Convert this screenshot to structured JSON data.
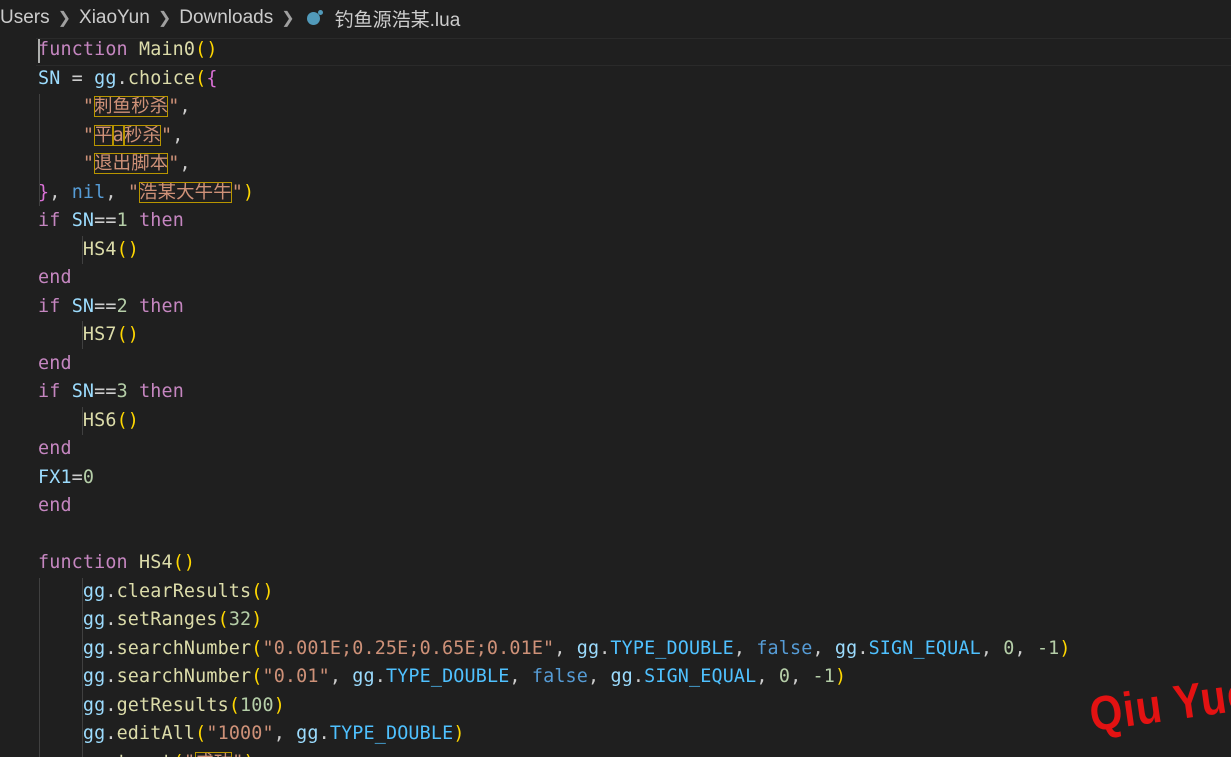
{
  "breadcrumb": {
    "items": [
      "Users",
      "XiaoYun",
      "Downloads"
    ],
    "file_name": "钓鱼源浩某.lua",
    "file_icon": "lua-file-icon"
  },
  "code": {
    "lines": [
      [
        [
          "kw",
          "function"
        ],
        [
          "pl",
          " "
        ],
        [
          "fn",
          "Main0"
        ],
        [
          "br1",
          "()"
        ]
      ],
      [
        [
          "vr",
          "SN"
        ],
        [
          "pl",
          " = "
        ],
        [
          "vr",
          "gg"
        ],
        [
          "pl",
          "."
        ],
        [
          "fn",
          "choice"
        ],
        [
          "br1",
          "("
        ],
        [
          "br2",
          "{"
        ]
      ],
      [
        [
          "pl",
          "    "
        ],
        [
          "st",
          "\""
        ],
        [
          "st",
          "刺鱼秒杀",
          "hl"
        ],
        [
          "st",
          "\""
        ],
        [
          "pl",
          ","
        ]
      ],
      [
        [
          "pl",
          "    "
        ],
        [
          "st",
          "\""
        ],
        [
          "st",
          "平",
          "hl"
        ],
        [
          "st",
          "a",
          "hl"
        ],
        [
          "st",
          "秒杀",
          "hl"
        ],
        [
          "st",
          "\""
        ],
        [
          "pl",
          ","
        ]
      ],
      [
        [
          "pl",
          "    "
        ],
        [
          "st",
          "\""
        ],
        [
          "st",
          "退出脚本",
          "hl"
        ],
        [
          "st",
          "\""
        ],
        [
          "pl",
          ","
        ]
      ],
      [
        [
          "br2",
          "}"
        ],
        [
          "pl",
          ", "
        ],
        [
          "kb",
          "nil"
        ],
        [
          "pl",
          ", "
        ],
        [
          "st",
          "\""
        ],
        [
          "st",
          "浩某大牛牛",
          "hl"
        ],
        [
          "st",
          "\""
        ],
        [
          "br1",
          ")"
        ]
      ],
      [
        [
          "kw",
          "if"
        ],
        [
          "pl",
          " "
        ],
        [
          "vr",
          "SN"
        ],
        [
          "pl",
          "=="
        ],
        [
          "nm",
          "1"
        ],
        [
          "pl",
          " "
        ],
        [
          "kw",
          "then"
        ]
      ],
      [
        [
          "pl",
          "    "
        ],
        [
          "fn",
          "HS4"
        ],
        [
          "br1",
          "()"
        ]
      ],
      [
        [
          "kw",
          "end"
        ]
      ],
      [
        [
          "kw",
          "if"
        ],
        [
          "pl",
          " "
        ],
        [
          "vr",
          "SN"
        ],
        [
          "pl",
          "=="
        ],
        [
          "nm",
          "2"
        ],
        [
          "pl",
          " "
        ],
        [
          "kw",
          "then"
        ]
      ],
      [
        [
          "pl",
          "    "
        ],
        [
          "fn",
          "HS7"
        ],
        [
          "br1",
          "()"
        ]
      ],
      [
        [
          "kw",
          "end"
        ]
      ],
      [
        [
          "kw",
          "if"
        ],
        [
          "pl",
          " "
        ],
        [
          "vr",
          "SN"
        ],
        [
          "pl",
          "=="
        ],
        [
          "nm",
          "3"
        ],
        [
          "pl",
          " "
        ],
        [
          "kw",
          "then"
        ]
      ],
      [
        [
          "pl",
          "    "
        ],
        [
          "fn",
          "HS6"
        ],
        [
          "br1",
          "()"
        ]
      ],
      [
        [
          "kw",
          "end"
        ]
      ],
      [
        [
          "vr",
          "FX1"
        ],
        [
          "pl",
          "="
        ],
        [
          "nm",
          "0"
        ]
      ],
      [
        [
          "kw",
          "end"
        ]
      ],
      [],
      [
        [
          "kw",
          "function"
        ],
        [
          "pl",
          " "
        ],
        [
          "fn",
          "HS4"
        ],
        [
          "br1",
          "()"
        ]
      ],
      [
        [
          "pl",
          "    "
        ],
        [
          "vr",
          "gg"
        ],
        [
          "pl",
          "."
        ],
        [
          "fn",
          "clearResults"
        ],
        [
          "br1",
          "()"
        ]
      ],
      [
        [
          "pl",
          "    "
        ],
        [
          "vr",
          "gg"
        ],
        [
          "pl",
          "."
        ],
        [
          "fn",
          "setRanges"
        ],
        [
          "br1",
          "("
        ],
        [
          "nm",
          "32"
        ],
        [
          "br1",
          ")"
        ]
      ],
      [
        [
          "pl",
          "    "
        ],
        [
          "vr",
          "gg"
        ],
        [
          "pl",
          "."
        ],
        [
          "fn",
          "searchNumber"
        ],
        [
          "br1",
          "("
        ],
        [
          "st",
          "\"0.001E;0.25E;0.65E;0.01E\""
        ],
        [
          "pl",
          ", "
        ],
        [
          "vr",
          "gg"
        ],
        [
          "pl",
          "."
        ],
        [
          "ct",
          "TYPE_DOUBLE"
        ],
        [
          "pl",
          ", "
        ],
        [
          "kb",
          "false"
        ],
        [
          "pl",
          ", "
        ],
        [
          "vr",
          "gg"
        ],
        [
          "pl",
          "."
        ],
        [
          "ct",
          "SIGN_EQUAL"
        ],
        [
          "pl",
          ", "
        ],
        [
          "nm",
          "0"
        ],
        [
          "pl",
          ", "
        ],
        [
          "nm",
          "-1"
        ],
        [
          "br1",
          ")"
        ]
      ],
      [
        [
          "pl",
          "    "
        ],
        [
          "vr",
          "gg"
        ],
        [
          "pl",
          "."
        ],
        [
          "fn",
          "searchNumber"
        ],
        [
          "br1",
          "("
        ],
        [
          "st",
          "\"0.01\""
        ],
        [
          "pl",
          ", "
        ],
        [
          "vr",
          "gg"
        ],
        [
          "pl",
          "."
        ],
        [
          "ct",
          "TYPE_DOUBLE"
        ],
        [
          "pl",
          ", "
        ],
        [
          "kb",
          "false"
        ],
        [
          "pl",
          ", "
        ],
        [
          "vr",
          "gg"
        ],
        [
          "pl",
          "."
        ],
        [
          "ct",
          "SIGN_EQUAL"
        ],
        [
          "pl",
          ", "
        ],
        [
          "nm",
          "0"
        ],
        [
          "pl",
          ", "
        ],
        [
          "nm",
          "-1"
        ],
        [
          "br1",
          ")"
        ]
      ],
      [
        [
          "pl",
          "    "
        ],
        [
          "vr",
          "gg"
        ],
        [
          "pl",
          "."
        ],
        [
          "fn",
          "getResults"
        ],
        [
          "br1",
          "("
        ],
        [
          "nm",
          "100"
        ],
        [
          "br1",
          ")"
        ]
      ],
      [
        [
          "pl",
          "    "
        ],
        [
          "vr",
          "gg"
        ],
        [
          "pl",
          "."
        ],
        [
          "fn",
          "editAll"
        ],
        [
          "br1",
          "("
        ],
        [
          "st",
          "\"1000\""
        ],
        [
          "pl",
          ", "
        ],
        [
          "vr",
          "gg"
        ],
        [
          "pl",
          "."
        ],
        [
          "ct",
          "TYPE_DOUBLE"
        ],
        [
          "br1",
          ")"
        ]
      ],
      [
        [
          "pl",
          "    "
        ],
        [
          "vr",
          "gg"
        ],
        [
          "pl",
          "."
        ],
        [
          "fn",
          "toast"
        ],
        [
          "br1",
          "("
        ],
        [
          "st",
          "\""
        ],
        [
          "st",
          "成功",
          "hl"
        ],
        [
          "st",
          "\""
        ],
        [
          "br1",
          ")"
        ]
      ]
    ]
  },
  "watermark": {
    "text": "Qiu Yue"
  }
}
